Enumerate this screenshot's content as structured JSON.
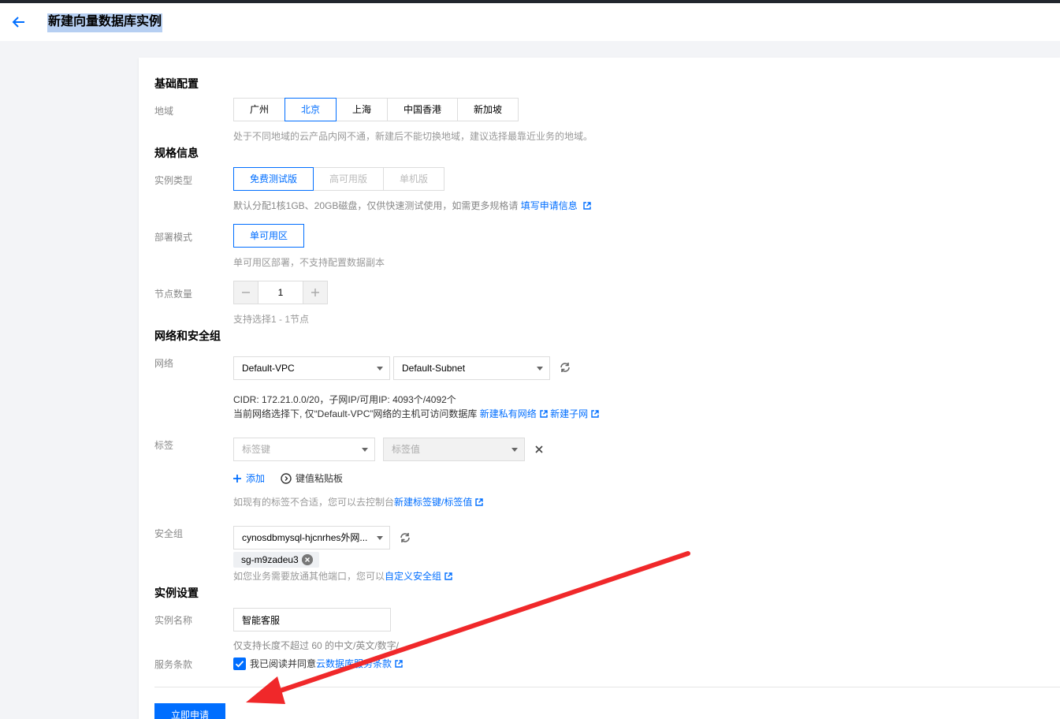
{
  "header": {
    "title": "新建向量数据库实例"
  },
  "sections": {
    "basic": "基础配置",
    "spec": "规格信息",
    "network": "网络和安全组",
    "instance": "实例设置"
  },
  "region": {
    "label": "地域",
    "options": [
      "广州",
      "北京",
      "上海",
      "中国香港",
      "新加坡"
    ],
    "selected": "北京",
    "hint": "处于不同地域的云产品内网不通，新建后不能切换地域，建议选择最靠近业务的地域。"
  },
  "instance_type": {
    "label": "实例类型",
    "options": [
      "免费测试版",
      "高可用版",
      "单机版"
    ],
    "selected": "免费测试版",
    "hint": "默认分配1核1GB、20GB磁盘，仅供快速测试使用，如需更多规格请",
    "hint_link": "填写申请信息"
  },
  "deploy_mode": {
    "label": "部署模式",
    "option": "单可用区",
    "hint": "单可用区部署，不支持配置数据副本"
  },
  "nodes": {
    "label": "节点数量",
    "value": "1",
    "hint": "支持选择1 - 1节点"
  },
  "network": {
    "label": "网络",
    "vpc": "Default-VPC",
    "subnet": "Default-Subnet",
    "cidr_text": "CIDR: 172.21.0.0/20，子网IP/可用IP: 4093个/4092个",
    "access_text": "当前网络选择下, 仅“Default-VPC”网络的主机可访问数据库",
    "link_new_vpc": "新建私有网络",
    "link_new_subnet": "新建子网"
  },
  "tags": {
    "label": "标签",
    "key_placeholder": "标签键",
    "value_placeholder": "标签值",
    "add_label": "添加",
    "paste_label": "键值粘贴板",
    "hint": "如现有的标签不合适，您可以去控制台",
    "hint_link": "新建标签键/标签值"
  },
  "security_group": {
    "label": "安全组",
    "selected": "cynosdbmysql-hjcnrhes外网...",
    "chip": "sg-m9zadeu3",
    "hint": "如您业务需要放通其他端口，您可以",
    "hint_link": "自定义安全组"
  },
  "instance_name": {
    "label": "实例名称",
    "value": "智能客服",
    "hint": "仅支持长度不超过 60 的中文/英文/数字/"
  },
  "terms": {
    "label": "服务条款",
    "text": "我已阅读并同意",
    "link": "云数据库服务条款"
  },
  "submit_label": "立即申请",
  "colors": {
    "accent": "#006eff",
    "arrow": "#f0282a"
  }
}
